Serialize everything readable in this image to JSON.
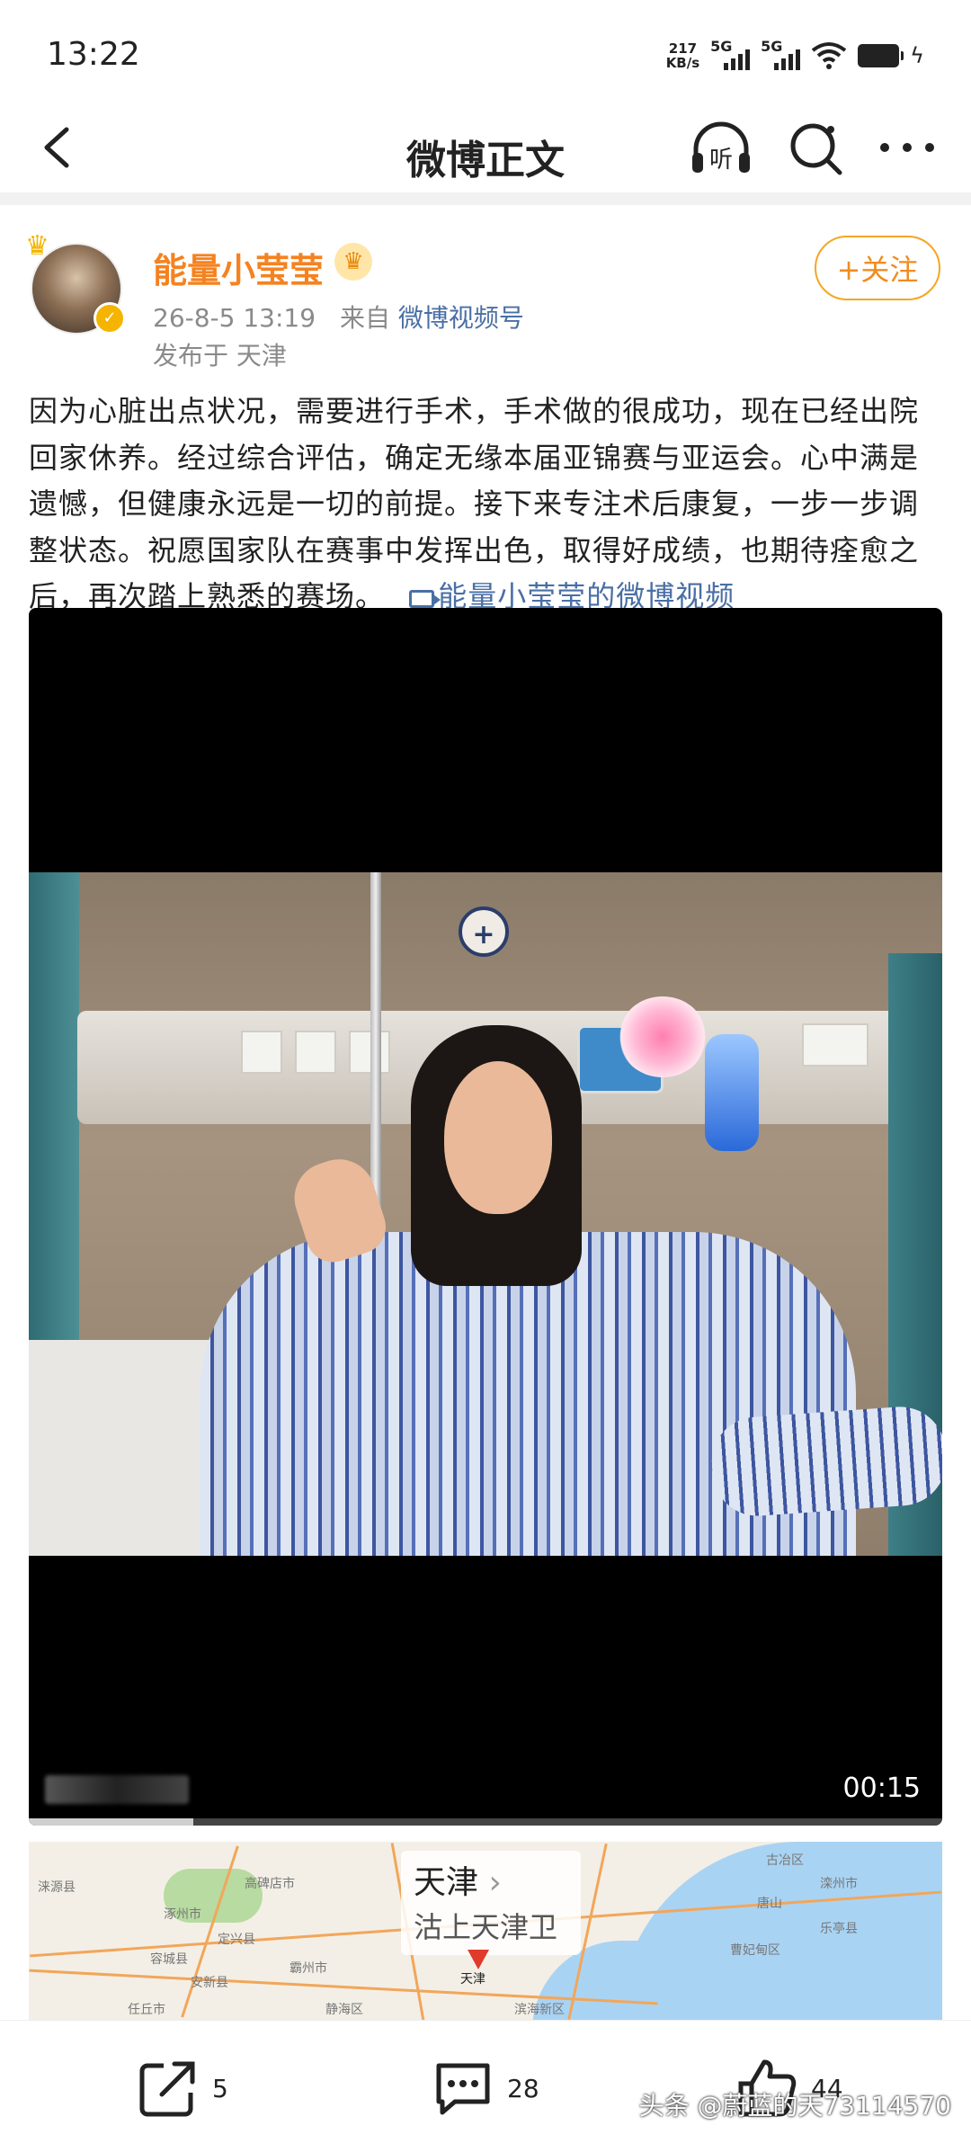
{
  "status_bar": {
    "time": "13:22",
    "net_speed_value": "217",
    "net_speed_unit": "KB/s",
    "signal_1": "5G",
    "signal_2": "5G"
  },
  "nav": {
    "title": "微博正文",
    "listen_label": "听"
  },
  "post": {
    "username": "能量小莹莹",
    "date": "26-8-5 13:19",
    "source_prefix": "来自",
    "source": "微博视频号",
    "published_at": "发布于 天津",
    "follow_label": "+关注",
    "content": "因为心脏出点状况，需要进行手术，手术做的很成功，现在已经出院回家休养。经过综合评估，确定无缘本届亚锦赛与亚运会。心中满是遗憾，但健康永远是一切的前提。接下来专注术后康复，一步一步调整状态。祝愿国家队在赛事中发挥出色，取得好成绩，也期待痊愈之后，再次踏上熟悉的赛场。",
    "video_link": "能量小莹莹的微博视频"
  },
  "video": {
    "duration": "00:15",
    "progress": 0.18
  },
  "map": {
    "city": "天津",
    "place": "沽上天津卫",
    "pin_label": "天津",
    "labels": [
      "涞源县",
      "涿州市",
      "高碑店市",
      "定兴县",
      "容城县",
      "安新县",
      "霸州市",
      "任丘市",
      "古冶区",
      "滦州市",
      "唐山",
      "乐亭县",
      "曹妃甸区",
      "静海区",
      "滨海新区"
    ]
  },
  "actions": {
    "share_count": "5",
    "comment_count": "28",
    "like_count": "44"
  },
  "watermark": "头条 @蔚蓝的天73114570",
  "colors": {
    "username": "#f58220",
    "link": "#4a6fa5",
    "follow_border": "#f5a623"
  }
}
